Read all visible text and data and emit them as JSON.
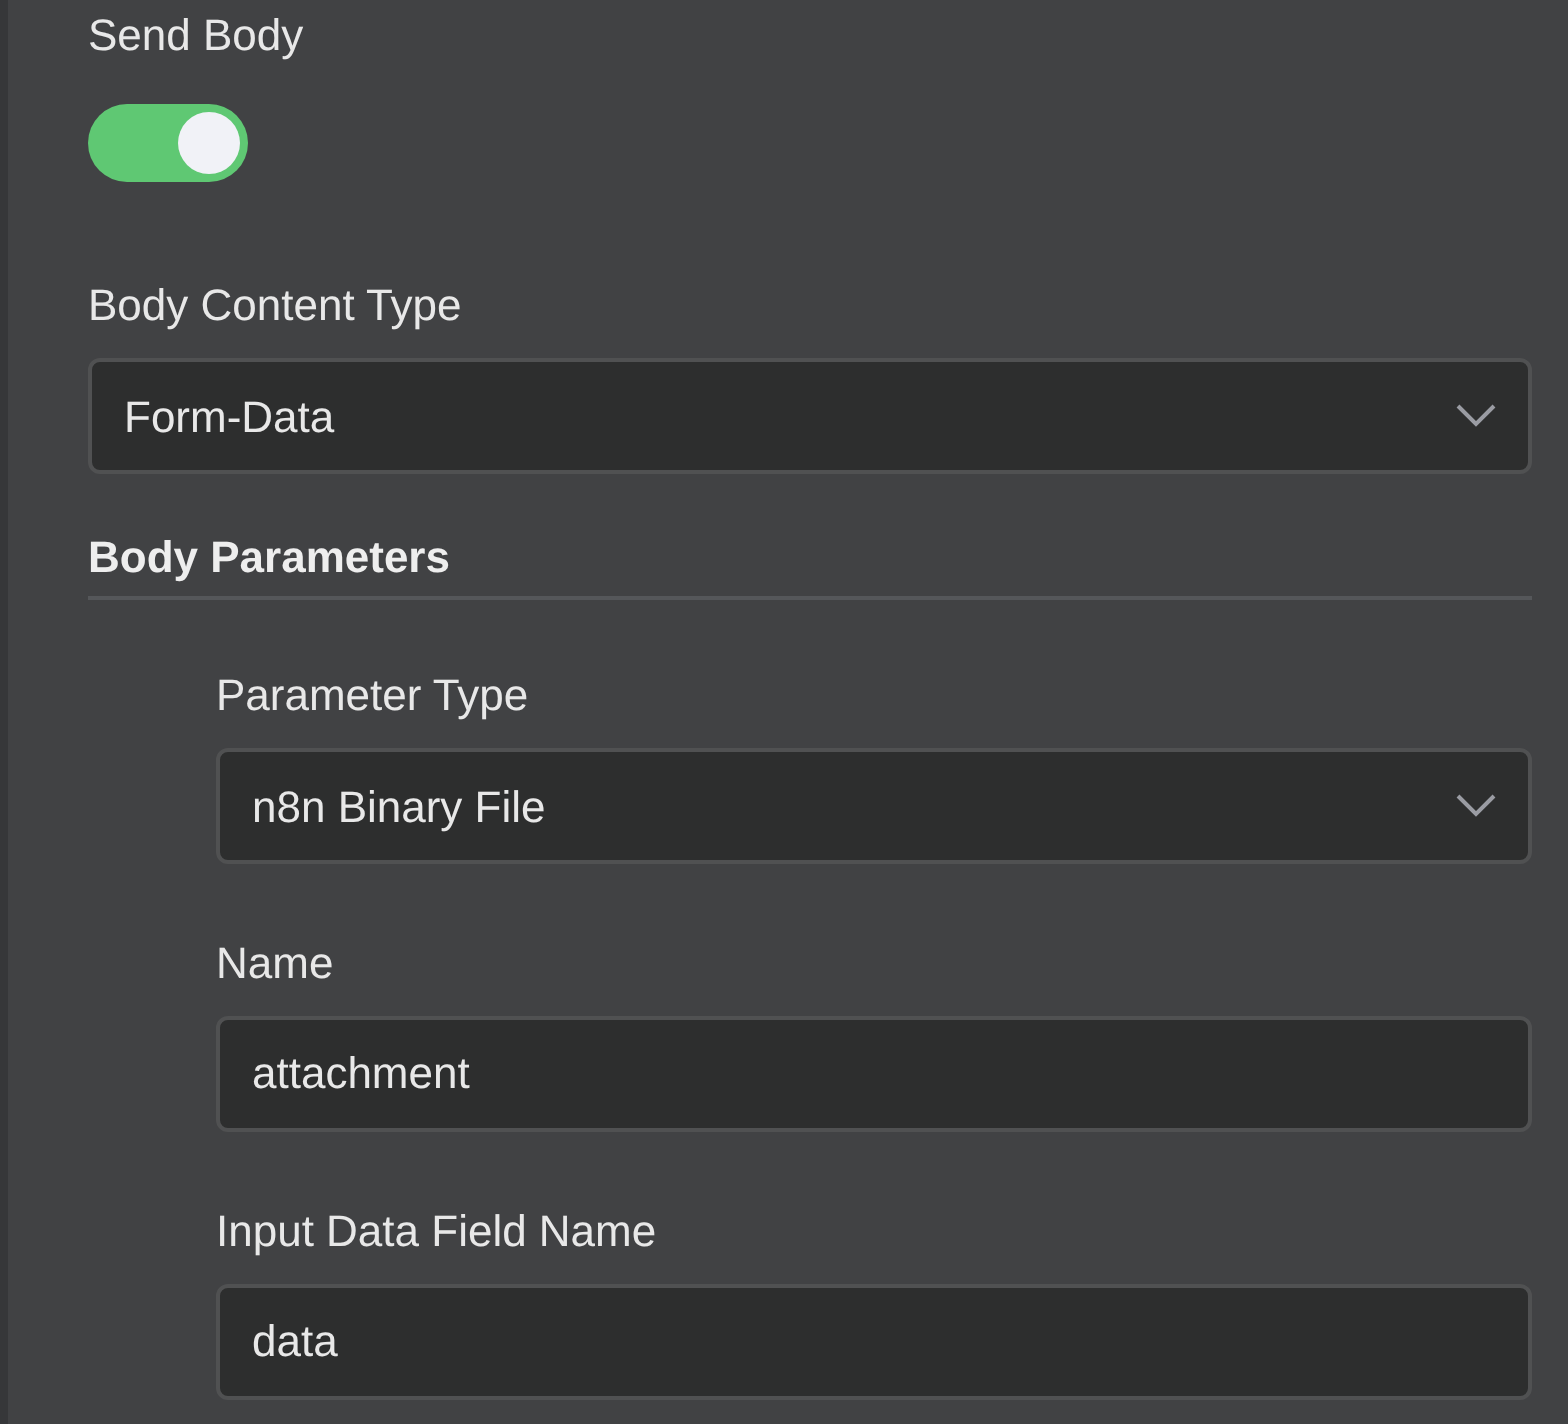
{
  "send_body": {
    "label": "Send Body",
    "on": true
  },
  "body_content_type": {
    "label": "Body Content Type",
    "value": "Form-Data"
  },
  "body_parameters": {
    "title": "Body Parameters",
    "fields": [
      {
        "kind": "select",
        "label": "Parameter Type",
        "value": "n8n Binary File"
      },
      {
        "kind": "input",
        "label": "Name",
        "value": "attachment"
      },
      {
        "kind": "input",
        "label": "Input Data Field Name",
        "value": "data"
      }
    ]
  }
}
